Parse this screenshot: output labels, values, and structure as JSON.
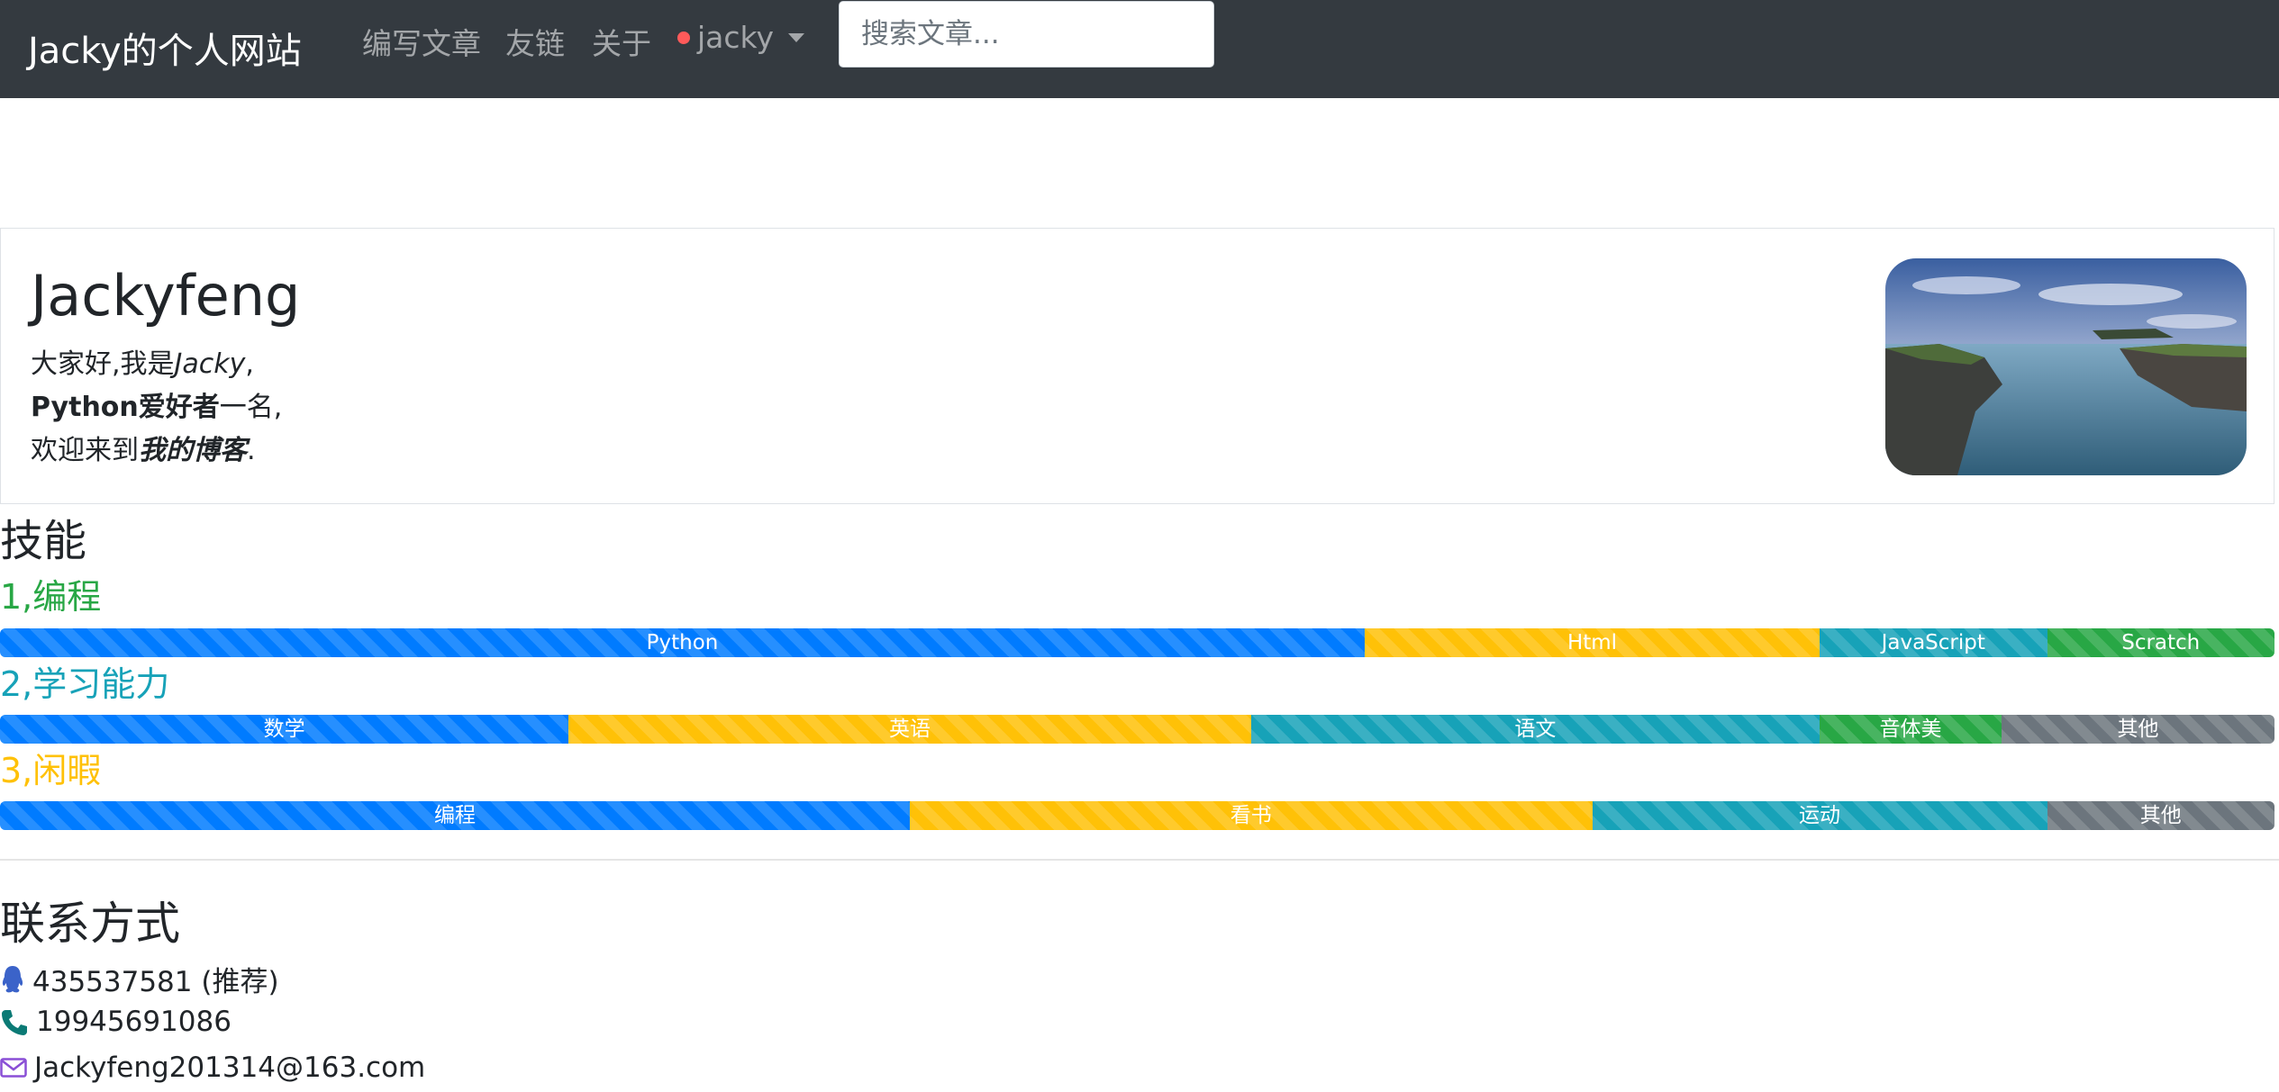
{
  "navbar": {
    "brand": "Jacky的个人网站",
    "links": [
      "编写文章",
      "友链",
      "关于"
    ],
    "user": "jacky",
    "search_placeholder": "搜索文章..."
  },
  "profile": {
    "name": "Jackyfeng",
    "intro": {
      "l1_a": "大家好,我是",
      "l1_b": "Jacky",
      "l1_c": ",",
      "l2_a": "Python爱好者",
      "l2_b": "一名,",
      "l3_a": "欢迎来到",
      "l3_b": "我的博客",
      "l3_c": "."
    }
  },
  "skills": {
    "title": "技能",
    "groups": [
      {
        "title": "1,编程",
        "title_color": "#28a745",
        "bars": [
          {
            "label": "Python",
            "percent": 60,
            "color": "#007bff"
          },
          {
            "label": "Html",
            "percent": 20,
            "color": "#ffc107"
          },
          {
            "label": "JavaScript",
            "percent": 10,
            "color": "#17a2b8"
          },
          {
            "label": "Scratch",
            "percent": 10,
            "color": "#28a745"
          }
        ]
      },
      {
        "title": "2,学习能力",
        "title_color": "#17a2b8",
        "bars": [
          {
            "label": "数学",
            "percent": 25,
            "color": "#007bff"
          },
          {
            "label": "英语",
            "percent": 30,
            "color": "#ffc107"
          },
          {
            "label": "语文",
            "percent": 25,
            "color": "#17a2b8"
          },
          {
            "label": "音体美",
            "percent": 8,
            "color": "#28a745"
          },
          {
            "label": "其他",
            "percent": 12,
            "color": "#6c757d"
          }
        ]
      },
      {
        "title": "3,闲暇",
        "title_color": "#ffc107",
        "bars": [
          {
            "label": "编程",
            "percent": 40,
            "color": "#007bff"
          },
          {
            "label": "看书",
            "percent": 30,
            "color": "#ffc107"
          },
          {
            "label": "运动",
            "percent": 20,
            "color": "#17a2b8"
          },
          {
            "label": "其他",
            "percent": 10,
            "color": "#6c757d"
          }
        ]
      }
    ]
  },
  "contact": {
    "title": "联系方式",
    "qq": "435537581 (推荐)",
    "phone": "19945691086",
    "email": "Jackyfeng201314@163.com"
  },
  "icons": {
    "qq": "qq-icon",
    "phone": "phone-icon",
    "email": "envelope-icon"
  }
}
